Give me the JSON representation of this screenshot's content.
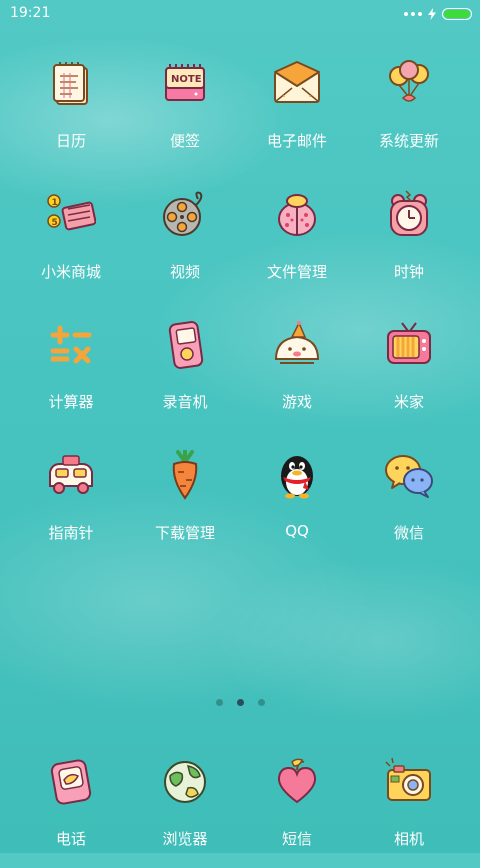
{
  "status_bar": {
    "time": "19:21",
    "battery_level": 1.0
  },
  "apps": [
    {
      "label": "日历",
      "icon": "calendar-notepad-icon"
    },
    {
      "label": "便签",
      "icon": "note-pad-icon"
    },
    {
      "label": "电子邮件",
      "icon": "envelope-icon"
    },
    {
      "label": "系统更新",
      "icon": "balloons-icon"
    },
    {
      "label": "小米商城",
      "icon": "cash-coins-icon"
    },
    {
      "label": "视频",
      "icon": "film-reel-icon"
    },
    {
      "label": "文件管理",
      "icon": "ladybug-icon"
    },
    {
      "label": "时钟",
      "icon": "alarm-clock-icon"
    },
    {
      "label": "计算器",
      "icon": "calculator-symbols-icon"
    },
    {
      "label": "录音机",
      "icon": "recorder-icon"
    },
    {
      "label": "游戏",
      "icon": "party-bird-icon"
    },
    {
      "label": "米家",
      "icon": "tv-icon"
    },
    {
      "label": "指南针",
      "icon": "car-icon"
    },
    {
      "label": "下载管理",
      "icon": "carrot-icon"
    },
    {
      "label": "QQ",
      "icon": "penguin-icon"
    },
    {
      "label": "微信",
      "icon": "chat-bubbles-icon"
    }
  ],
  "page_indicator": {
    "count": 3,
    "active": 2
  },
  "dock": [
    {
      "label": "电话",
      "icon": "phone-icon"
    },
    {
      "label": "浏览器",
      "icon": "globe-icon"
    },
    {
      "label": "短信",
      "icon": "heart-icon"
    },
    {
      "label": "相机",
      "icon": "camera-icon"
    }
  ],
  "colors": {
    "background": "#48c4c0",
    "battery": "#3ddc3d"
  }
}
